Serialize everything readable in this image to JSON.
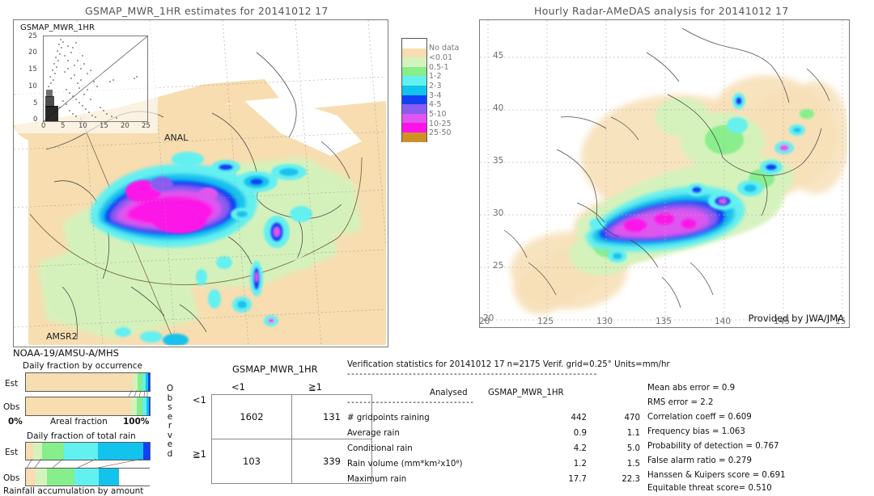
{
  "left_panel": {
    "title": "GSMAP_MWR_1HR estimates for 20141012 17",
    "inset_title": "GSMAP_MWR_1HR",
    "inset_xlabel": "ANAL",
    "inset_yticks": [
      "25",
      "20",
      "15",
      "10",
      "5",
      "0"
    ],
    "inset_xticks": [
      "0",
      "5",
      "10",
      "15",
      "20",
      "25"
    ],
    "sensor_in_map": "AMSR2",
    "sensor_below": "NOAA-19/AMSU-A/MHS"
  },
  "right_panel": {
    "title": "Hourly Radar-AMeDAS analysis for 20141012 17",
    "credit": "Provided by JWA/JMA",
    "lon_ticks": [
      "20",
      "125",
      "130",
      "135",
      "140",
      "145",
      "15"
    ],
    "lat_ticks": [
      "45",
      "40",
      "35",
      "30",
      "25",
      "20"
    ],
    "corner_lat": "20"
  },
  "colorbar": {
    "units": "mm/hr",
    "entries": [
      {
        "label": "No data",
        "color": "#ffffff"
      },
      {
        "label": "<0.01",
        "color": "#f7ddb0"
      },
      {
        "label": "0.5-1",
        "color": "#d4f3bc"
      },
      {
        "label": "1-2",
        "color": "#86ee8a"
      },
      {
        "label": "2-3",
        "color": "#63f0f0"
      },
      {
        "label": "3-4",
        "color": "#12c3ee"
      },
      {
        "label": "4-5",
        "color": "#1042f5"
      },
      {
        "label": "5-10",
        "color": "#8a5cf0"
      },
      {
        "label": "10-25",
        "color": "#df55ef"
      },
      {
        "label": "25-50",
        "color": "#fd12e8"
      },
      {
        "label": "",
        "color": "#cf9028"
      }
    ]
  },
  "contingency": {
    "header": "GSMAP_MWR_1HR",
    "col_labels": [
      "<1",
      "≧1"
    ],
    "row_labels": [
      "<1",
      "≧1"
    ],
    "side_label": "Observed",
    "values": [
      [
        "1602",
        "131"
      ],
      [
        "103",
        "339"
      ]
    ]
  },
  "verification": {
    "header": "Verification statistics for 20141012 17  n=2175  Verif. grid=0.25°  Units=mm/hr",
    "divider": "-------------------------------------------------------------",
    "col_headers": [
      "Analysed",
      "GSMAP_MWR_1HR"
    ],
    "subdivider": "-------------------------------",
    "rows": [
      {
        "label": "# gridpoints raining",
        "analysed": "442",
        "estimate": "470"
      },
      {
        "label": "Average rain",
        "analysed": "0.9",
        "estimate": "1.1"
      },
      {
        "label": "Conditional rain",
        "analysed": "4.2",
        "estimate": "5.0"
      },
      {
        "label": "Rain volume (mm*km²x10⁸)",
        "analysed": "1.2",
        "estimate": "1.5"
      },
      {
        "label": "Maximum rain",
        "analysed": "17.7",
        "estimate": "22.3"
      }
    ],
    "scores": [
      "Mean abs error = 0.9",
      "RMS error = 2.2",
      "Correlation coeff = 0.609",
      "Frequency bias = 1.063",
      "Probability of detection = 0.767",
      "False alarm ratio = 0.279",
      "Hanssen & Kuipers score = 0.691",
      "Equitable threat score= 0.510"
    ]
  },
  "bars": {
    "chart1_title": "Daily fraction by occurrence",
    "chart1_axis_left": "0%",
    "chart1_axis_mid": "Areal fraction",
    "chart1_axis_right": "100%",
    "chart2_title": "Daily fraction of total rain",
    "chart2_caption": "Rainfall accumulation by amount",
    "row_labels": [
      "Est",
      "Obs"
    ],
    "chart1_est": [
      {
        "color": "#f7ddb0",
        "pct": 86.0
      },
      {
        "color": "#d4f3bc",
        "pct": 4.0
      },
      {
        "color": "#86ee8a",
        "pct": 4.0
      },
      {
        "color": "#63f0f0",
        "pct": 3.0
      },
      {
        "color": "#12c3ee",
        "pct": 2.0
      },
      {
        "color": "#1042f5",
        "pct": 1.0
      }
    ],
    "chart1_obs": [
      {
        "color": "#f7ddb0",
        "pct": 85.0
      },
      {
        "color": "#d4f3bc",
        "pct": 4.5
      },
      {
        "color": "#86ee8a",
        "pct": 4.5
      },
      {
        "color": "#63f0f0",
        "pct": 3.5
      },
      {
        "color": "#12c3ee",
        "pct": 2.0
      },
      {
        "color": "#1042f5",
        "pct": 0.5
      }
    ],
    "chart2_est": [
      {
        "color": "#f7ddb0",
        "pct": 6.0
      },
      {
        "color": "#d4f3bc",
        "pct": 7.0
      },
      {
        "color": "#86ee8a",
        "pct": 18.0
      },
      {
        "color": "#63f0f0",
        "pct": 27.0
      },
      {
        "color": "#12c3ee",
        "pct": 37.0
      },
      {
        "color": "#1042f5",
        "pct": 5.0
      }
    ],
    "chart2_obs": [
      {
        "color": "#f7ddb0",
        "pct": 8.0
      },
      {
        "color": "#d4f3bc",
        "pct": 9.0
      },
      {
        "color": "#86ee8a",
        "pct": 22.0
      },
      {
        "color": "#63f0f0",
        "pct": 20.0
      },
      {
        "color": "#12c3ee",
        "pct": 16.0
      }
    ]
  }
}
